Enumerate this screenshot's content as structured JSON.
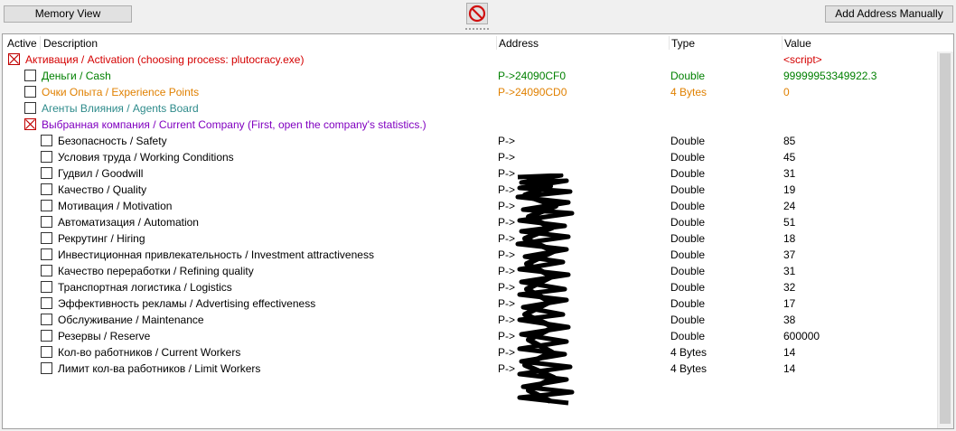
{
  "toolbar": {
    "memory_view_label": "Memory View",
    "add_address_label": "Add Address Manually"
  },
  "columns": {
    "active": "Active",
    "description": "Description",
    "address": "Address",
    "type": "Type",
    "value": "Value"
  },
  "colors": {
    "red": "#d40000",
    "green": "#008000",
    "orange": "#e08000",
    "teal": "#2e8b8b",
    "purple": "#8000c0",
    "black": "#000000"
  },
  "rows": [
    {
      "description": "Активация / Activation (choosing process: plutocracy.exe)",
      "address": "",
      "type": "",
      "value": "<script>",
      "checked": true
    },
    {
      "description": "Деньги / Cash",
      "address": "P->24090CF0",
      "type": "Double",
      "value": "99999953349922.3",
      "checked": false
    },
    {
      "description": "Очки Опыта / Experience Points",
      "address": "P->24090CD0",
      "type": "4 Bytes",
      "value": "0",
      "checked": false
    },
    {
      "description": "Агенты Влияния / Agents Board",
      "address": "",
      "type": "",
      "value": "",
      "checked": false
    },
    {
      "description": "Выбранная компания / Current Company (First, open the company's statistics.)",
      "address": "",
      "type": "",
      "value": "",
      "checked": true
    },
    {
      "description": "Безопасность / Safety",
      "address": "P->",
      "type": "Double",
      "value": "85",
      "checked": false
    },
    {
      "description": "Условия труда / Working Conditions",
      "address": "P->",
      "type": "Double",
      "value": "45",
      "checked": false
    },
    {
      "description": "Гудвил / Goodwill",
      "address": "P->",
      "type": "Double",
      "value": "31",
      "checked": false
    },
    {
      "description": "Качество / Quality",
      "address": "P->",
      "type": "Double",
      "value": "19",
      "checked": false
    },
    {
      "description": "Мотивация / Motivation",
      "address": "P->",
      "type": "Double",
      "value": "24",
      "checked": false
    },
    {
      "description": "Автоматизация / Automation",
      "address": "P->",
      "type": "Double",
      "value": "51",
      "checked": false
    },
    {
      "description": "Рекрутинг / Hiring",
      "address": "P->",
      "type": "Double",
      "value": "18",
      "checked": false
    },
    {
      "description": "Инвестиционная привлекательность / Investment attractiveness",
      "address": "P->",
      "type": "Double",
      "value": "37",
      "checked": false
    },
    {
      "description": "Качество переработки / Refining quality",
      "address": "P->",
      "type": "Double",
      "value": "31",
      "checked": false
    },
    {
      "description": "Транспортная логистика / Logistics",
      "address": "P->",
      "type": "Double",
      "value": "32",
      "checked": false
    },
    {
      "description": "Эффективность рекламы / Advertising effectiveness",
      "address": "P->",
      "type": "Double",
      "value": "17",
      "checked": false
    },
    {
      "description": "Обслуживание / Maintenance",
      "address": "P->",
      "type": "Double",
      "value": "38",
      "checked": false
    },
    {
      "description": "Резервы / Reserve",
      "address": "P->",
      "type": "Double",
      "value": "600000",
      "checked": false
    },
    {
      "description": "Кол-во работников / Current Workers",
      "address": "P->",
      "type": "4 Bytes",
      "value": "14",
      "checked": false
    },
    {
      "description": "Лимит кол-ва работников / Limit Workers",
      "address": "P->",
      "type": "4 Bytes",
      "value": "14",
      "checked": false
    }
  ]
}
